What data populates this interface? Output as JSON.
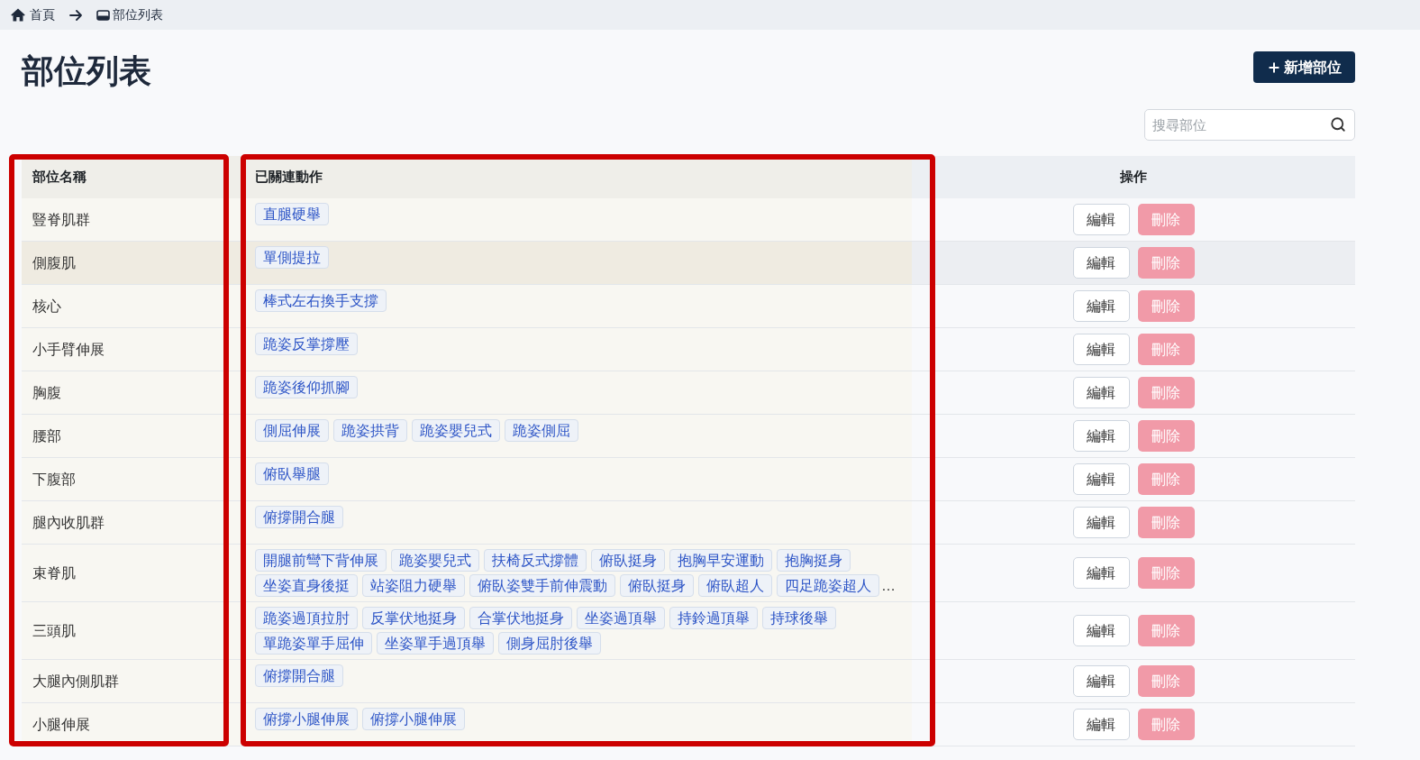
{
  "breadcrumb": [
    {
      "kind": "home",
      "label": "首頁"
    },
    {
      "kind": "current",
      "label": "部位列表"
    }
  ],
  "title": "部位列表",
  "add_button": {
    "label": "新增部位"
  },
  "search": {
    "placeholder": "搜尋部位"
  },
  "table": {
    "columns": [
      {
        "label": "部位名稱",
        "highlighted": true
      },
      {
        "label": "已關連動作",
        "highlighted": true
      },
      {
        "label": "操作",
        "highlighted": false
      }
    ],
    "rows": [
      {
        "name": "豎脊肌群",
        "hovered": false,
        "actions": [
          "直腿硬舉"
        ],
        "buttons": [
          {
            "kind": "edit",
            "label": "編輯",
            "disabled": false
          },
          {
            "kind": "delete",
            "label": "刪除",
            "disabled": true
          }
        ]
      },
      {
        "name": "側腹肌",
        "hovered": true,
        "actions": [
          "單側提拉"
        ],
        "buttons": [
          {
            "kind": "edit",
            "label": "編輯",
            "disabled": false
          },
          {
            "kind": "delete",
            "label": "刪除",
            "disabled": true
          }
        ]
      },
      {
        "name": "核心",
        "hovered": false,
        "actions": [
          "棒式左右換手支撐"
        ],
        "buttons": [
          {
            "kind": "edit",
            "label": "編輯",
            "disabled": false
          },
          {
            "kind": "delete",
            "label": "刪除",
            "disabled": true
          }
        ]
      },
      {
        "name": "小手臂伸展",
        "hovered": false,
        "actions": [
          "跪姿反掌撐壓"
        ],
        "buttons": [
          {
            "kind": "edit",
            "label": "編輯",
            "disabled": false
          },
          {
            "kind": "delete",
            "label": "刪除",
            "disabled": true
          }
        ]
      },
      {
        "name": "胸腹",
        "hovered": false,
        "actions": [
          "跪姿後仰抓腳"
        ],
        "buttons": [
          {
            "kind": "edit",
            "label": "編輯",
            "disabled": false
          },
          {
            "kind": "delete",
            "label": "刪除",
            "disabled": true
          }
        ]
      },
      {
        "name": "腰部",
        "hovered": false,
        "actions": [
          "側屈伸展",
          "跪姿拱背",
          "跪姿嬰兒式",
          "跪姿側屈"
        ],
        "buttons": [
          {
            "kind": "edit",
            "label": "編輯",
            "disabled": false
          },
          {
            "kind": "delete",
            "label": "刪除",
            "disabled": true
          }
        ]
      },
      {
        "name": "下腹部",
        "hovered": false,
        "actions": [
          "俯臥舉腿"
        ],
        "buttons": [
          {
            "kind": "edit",
            "label": "編輯",
            "disabled": false
          },
          {
            "kind": "delete",
            "label": "刪除",
            "disabled": true
          }
        ]
      },
      {
        "name": "腿內收肌群",
        "hovered": false,
        "actions": [
          "俯撐開合腿"
        ],
        "buttons": [
          {
            "kind": "edit",
            "label": "編輯",
            "disabled": false
          },
          {
            "kind": "delete",
            "label": "刪除",
            "disabled": true
          }
        ]
      },
      {
        "name": "束脊肌",
        "hovered": false,
        "actions": [
          "開腿前彎下背伸展",
          "跪姿嬰兒式",
          "扶椅反式撐體",
          "俯臥挺身",
          "抱胸早安運動",
          "抱胸挺身",
          "坐姿直身後挺",
          "站姿阻力硬舉",
          "俯臥姿雙手前伸震動",
          "俯臥挺身",
          "俯臥超人",
          "四足跪姿超人"
        ],
        "more": "…",
        "buttons": [
          {
            "kind": "edit",
            "label": "編輯",
            "disabled": false
          },
          {
            "kind": "delete",
            "label": "刪除",
            "disabled": true
          }
        ]
      },
      {
        "name": "三頭肌",
        "hovered": false,
        "actions": [
          "跪姿過頂拉肘",
          "反掌伏地挺身",
          "合掌伏地挺身",
          "坐姿過頂舉",
          "持鈴過頂舉",
          "持球後舉",
          "單跪姿單手屈伸",
          "坐姿單手過頂舉",
          "側身屈肘後舉"
        ],
        "buttons": [
          {
            "kind": "edit",
            "label": "編輯",
            "disabled": false
          },
          {
            "kind": "delete",
            "label": "刪除",
            "disabled": true
          }
        ]
      },
      {
        "name": "大腿內側肌群",
        "hovered": false,
        "actions": [
          "俯撐開合腿"
        ],
        "buttons": [
          {
            "kind": "edit",
            "label": "編輯",
            "disabled": false
          },
          {
            "kind": "delete",
            "label": "刪除",
            "disabled": true
          }
        ]
      },
      {
        "name": "小腿伸展",
        "hovered": false,
        "actions": [
          "俯撐小腿伸展",
          "俯撐小腿伸展"
        ],
        "buttons": [
          {
            "kind": "edit",
            "label": "編輯",
            "disabled": false
          },
          {
            "kind": "delete",
            "label": "刪除",
            "disabled": true
          }
        ]
      }
    ]
  }
}
